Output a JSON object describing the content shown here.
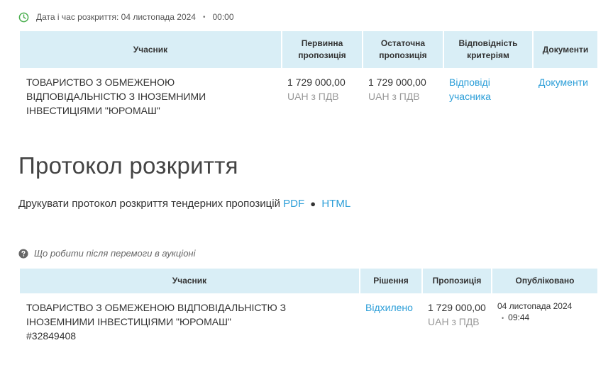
{
  "opening": {
    "label": "Дата і час розкриття: 04 листопада 2024",
    "time": "00:00"
  },
  "offers": {
    "headers": {
      "participant": "Учасник",
      "initial": "Первинна пропозиція",
      "final": "Остаточна пропозиція",
      "criteria": "Відповідність критеріям",
      "documents": "Документи"
    },
    "row": {
      "name": "ТОВАРИСТВО З ОБМЕЖЕНОЮ ВІДПОВІДАЛЬНІСТЮ З ІНОЗЕМНИМИ ІНВЕСТИЦІЯМИ \"ЮРОМАШ\"",
      "initial_amount": "1 729 000,00",
      "initial_currency": "UAH з ПДВ",
      "final_amount": "1 729 000,00",
      "final_currency": "UAH з ПДВ",
      "criteria_link": "Відповіді учасника",
      "documents_link": "Документи"
    }
  },
  "protocol": {
    "title": "Протокол розкриття",
    "print_text": "Друкувати протокол розкриття тендерних пропозицій",
    "pdf": "PDF",
    "separator": "●",
    "html": "HTML"
  },
  "help": {
    "text": "Що робити після перемоги в аукціоні"
  },
  "results": {
    "headers": {
      "participant": "Учасник",
      "decision": "Рішення",
      "offer": "Пропозиція",
      "published": "Опубліковано"
    },
    "row": {
      "name": "ТОВАРИСТВО З ОБМЕЖЕНОЮ ВІДПОВІДАЛЬНІСТЮ З ІНОЗЕМНИМИ ІНВЕСТИЦІЯМИ \"ЮРОМАШ\"",
      "code": "#32849408",
      "decision": "Відхилено",
      "offer_amount": "1 729 000,00",
      "offer_currency": "UAH з ПДВ",
      "published_date": "04 листопада 2024",
      "published_time": "09:44"
    }
  },
  "colors": {
    "header_bg": "#d9eef6",
    "link": "#2b9ed8",
    "clock_icon": "#4caf50",
    "muted": "#999999"
  },
  "icons": {
    "clock": "clock-icon",
    "question": "question-circle-icon"
  }
}
